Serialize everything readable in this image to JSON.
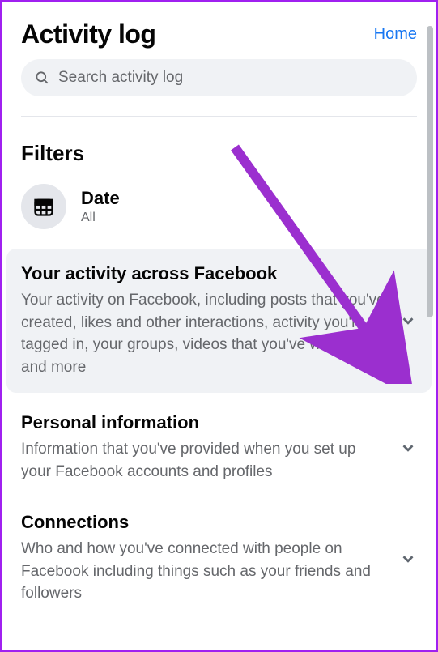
{
  "header": {
    "title": "Activity log",
    "home_link": "Home"
  },
  "search": {
    "placeholder": "Search activity log"
  },
  "filters": {
    "heading": "Filters",
    "date": {
      "label": "Date",
      "value": "All"
    }
  },
  "categories": [
    {
      "title": "Your activity across Facebook",
      "desc": "Your activity on Facebook, including posts that you've created, likes and other interactions, activity you're tagged in, your groups, videos that you've watched and more",
      "selected": true
    },
    {
      "title": "Personal information",
      "desc": "Information that you've provided when you set up your Facebook accounts and profiles",
      "selected": false
    },
    {
      "title": "Connections",
      "desc": "Who and how you've connected with people on Facebook including things such as your friends and followers",
      "selected": false
    }
  ],
  "annotation": {
    "arrow_color": "#9b2fcf"
  }
}
